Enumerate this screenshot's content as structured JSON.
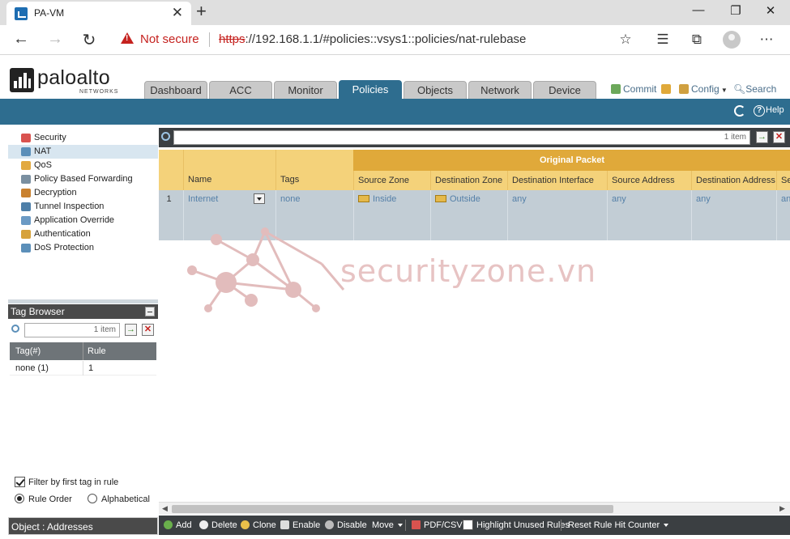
{
  "browser": {
    "tab_title": "PA-VM",
    "not_secure": "Not secure",
    "url_scheme": "https",
    "url_rest": "://192.168.1.1/#policies::vsys1::policies/nat-rulebase"
  },
  "brand": {
    "name": "paloalto",
    "sub": "NETWORKS"
  },
  "main_tabs": [
    "Dashboard",
    "ACC",
    "Monitor",
    "Policies",
    "Objects",
    "Network",
    "Device"
  ],
  "active_tab": "Policies",
  "header_tools": {
    "commit": "Commit",
    "config": "Config",
    "search": "Search"
  },
  "help": "Help",
  "policy_tree": [
    {
      "label": "Security",
      "icon": "security-icon"
    },
    {
      "label": "NAT",
      "icon": "nat-icon",
      "selected": true
    },
    {
      "label": "QoS",
      "icon": "qos-icon"
    },
    {
      "label": "Policy Based Forwarding",
      "icon": "pbf-icon"
    },
    {
      "label": "Decryption",
      "icon": "decryption-icon"
    },
    {
      "label": "Tunnel Inspection",
      "icon": "tunnel-icon"
    },
    {
      "label": "Application Override",
      "icon": "app-override-icon"
    },
    {
      "label": "Authentication",
      "icon": "authentication-icon"
    },
    {
      "label": "DoS Protection",
      "icon": "dos-icon"
    }
  ],
  "tag_browser": {
    "title": "Tag Browser",
    "search_count": "1 item",
    "col_tag": "Tag(#)",
    "col_rule": "Rule",
    "rows": [
      {
        "tag": "none (1)",
        "rule": "1"
      }
    ],
    "filter_label": "Filter by first tag in rule",
    "filter_checked": true,
    "sort_rule_order": "Rule Order",
    "sort_alpha": "Alphabetical"
  },
  "object_footer": "Object : Addresses",
  "grid": {
    "search_count": "1 item",
    "group_header": "Original Packet",
    "columns": [
      "Name",
      "Tags",
      "Source Zone",
      "Destination Zone",
      "Destination Interface",
      "Source Address",
      "Destination Address",
      "Se"
    ],
    "rows": [
      {
        "num": "1",
        "name": "Internet",
        "tags": "none",
        "source_zone": "Inside",
        "destination_zone": "Outside",
        "destination_interface": "any",
        "source_address": "any",
        "destination_address": "any",
        "service": "an"
      }
    ]
  },
  "watermark": "securityzone.vn",
  "toolbar": {
    "add": "Add",
    "delete": "Delete",
    "clone": "Clone",
    "enable": "Enable",
    "disable": "Disable",
    "move": "Move",
    "pdf_csv": "PDF/CSV",
    "highlight": "Highlight Unused Rules",
    "reset": "Reset Rule Hit Counter"
  },
  "colors": {
    "accent": "#2e6d8f",
    "header_band": "#e0a93a",
    "header_cols": "#f4d27a",
    "row_bg": "#c2cdd5",
    "warning": "#c5221f"
  }
}
